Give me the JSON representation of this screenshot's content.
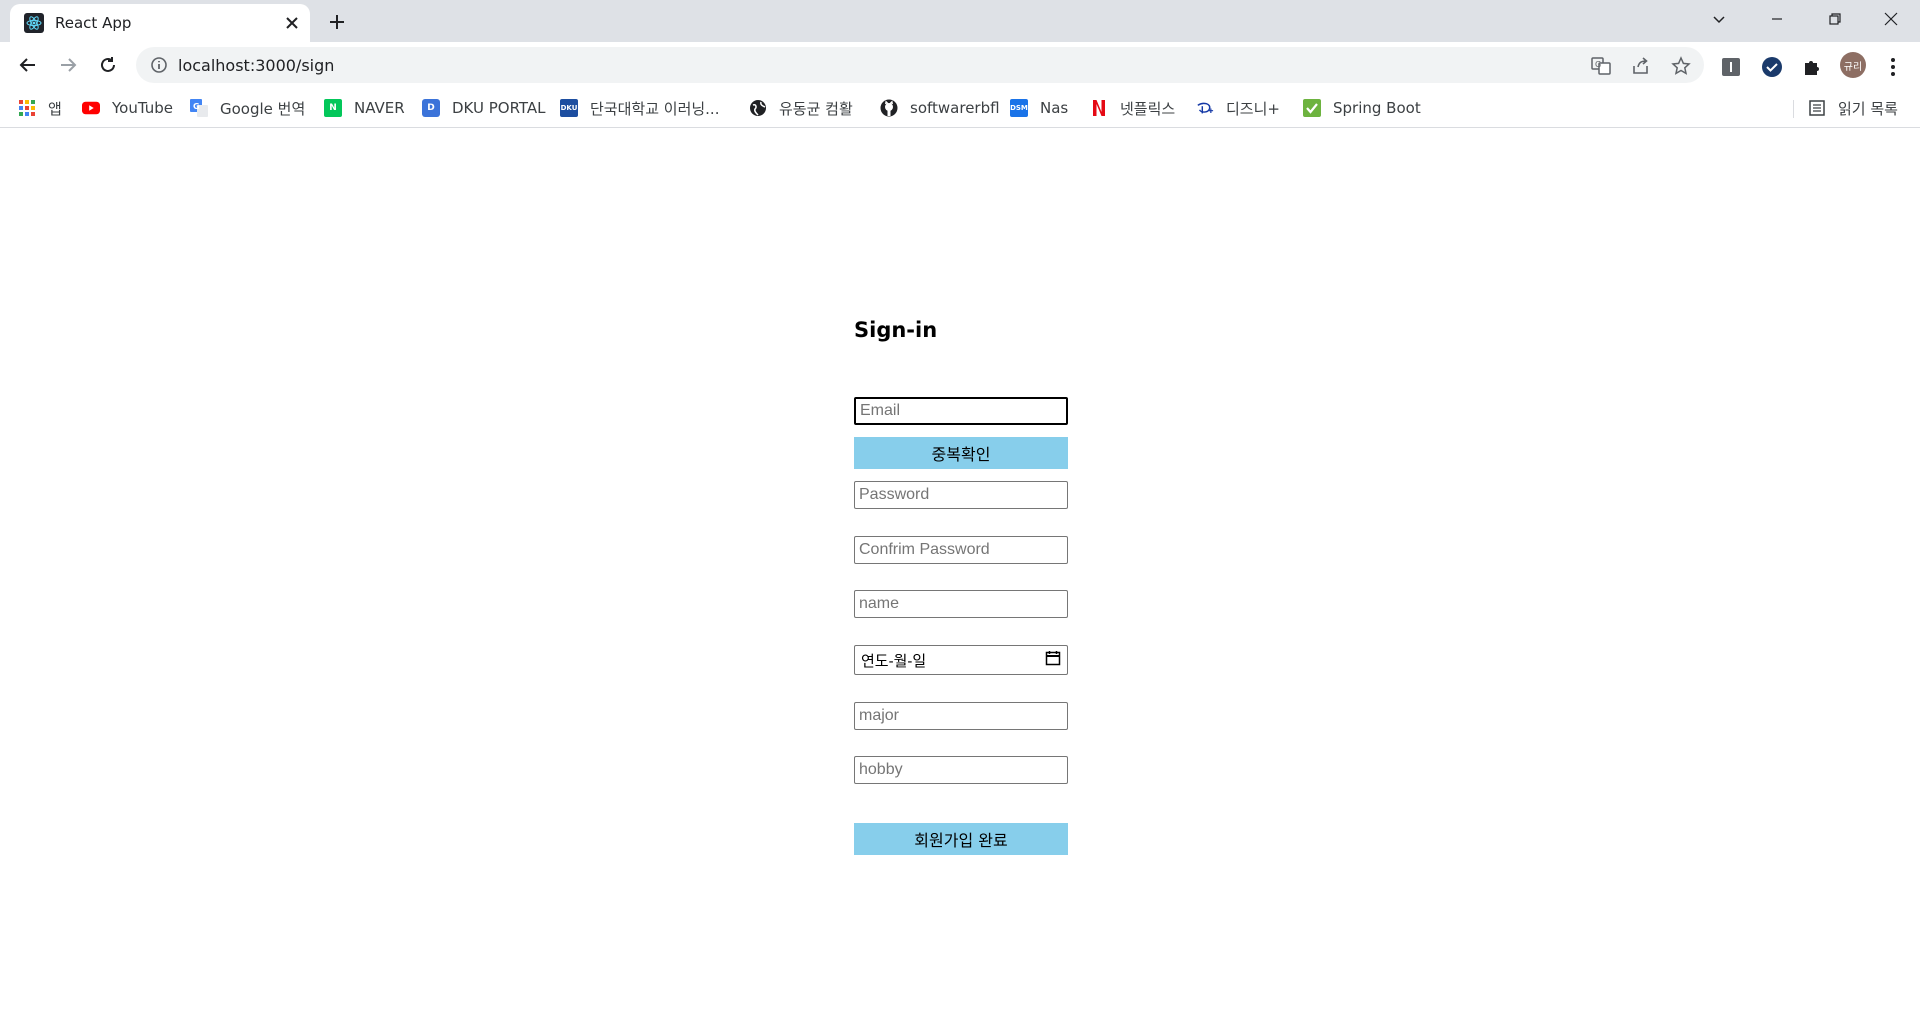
{
  "browser": {
    "tab": {
      "title": "React App"
    },
    "url": "localhost:3000/sign",
    "profile_initials": "규리",
    "bookmarks": [
      {
        "label": "앱",
        "icon": "apps-grid-icon",
        "color": "#ea4335"
      },
      {
        "label": "YouTube",
        "icon": "youtube-icon",
        "color": "#ff0000"
      },
      {
        "label": "Google 번역",
        "icon": "google-translate-icon",
        "color": "#4285f4"
      },
      {
        "label": "NAVER",
        "icon": "naver-icon",
        "color": "#03c75a"
      },
      {
        "label": "DKU PORTAL",
        "icon": "dku-portal-icon",
        "color": "#3b73d9"
      },
      {
        "label": "단국대학교 이러닝...",
        "icon": "dku-elearning-icon",
        "color": "#1d4ea0"
      },
      {
        "label": "유동균 컴활",
        "icon": "globe-icon",
        "color": "#202124"
      },
      {
        "label": "softwarerbfl",
        "icon": "github-icon",
        "color": "#202124"
      },
      {
        "label": "Nas",
        "icon": "dsm-icon",
        "color": "#1a73e8"
      },
      {
        "label": "넷플릭스",
        "icon": "netflix-icon",
        "color": "#e50914"
      },
      {
        "label": "디즈니+",
        "icon": "disney-plus-icon",
        "color": "#1438a6"
      },
      {
        "label": "Spring Boot",
        "icon": "spring-boot-icon",
        "color": "#6db33f"
      }
    ],
    "reading_list": "읽기 목록"
  },
  "form": {
    "title": "Sign-in",
    "email_placeholder": "Email",
    "check_duplicate_label": "중복확인",
    "password_placeholder": "Password",
    "confirm_password_placeholder": "Confrim Password",
    "name_placeholder": "name",
    "birthdate_placeholder": "연도-월-일",
    "major_placeholder": "major",
    "hobby_placeholder": "hobby",
    "submit_label": "회원가입 완료"
  },
  "colors": {
    "button_bg": "#87ceeb",
    "tabstrip_bg": "#dee1e6"
  }
}
